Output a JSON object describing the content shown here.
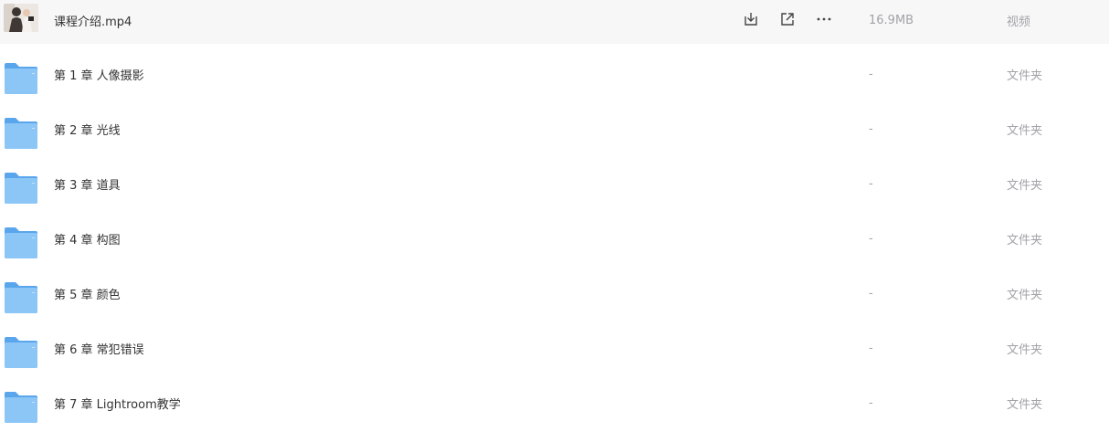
{
  "files": [
    {
      "name": "课程介绍.mp4",
      "size": "16.9MB",
      "type": "视频",
      "icon": "video-thumbnail"
    },
    {
      "name": "第 1 章 人像摄影",
      "size": "-",
      "type": "文件夹",
      "icon": "folder-icon"
    },
    {
      "name": "第 2 章 光线",
      "size": "-",
      "type": "文件夹",
      "icon": "folder-icon"
    },
    {
      "name": "第 3 章 道具",
      "size": "-",
      "type": "文件夹",
      "icon": "folder-icon"
    },
    {
      "name": "第 4 章 构图",
      "size": "-",
      "type": "文件夹",
      "icon": "folder-icon"
    },
    {
      "name": "第 5 章 颜色",
      "size": "-",
      "type": "文件夹",
      "icon": "folder-icon"
    },
    {
      "name": "第 6 章 常犯错误",
      "size": "-",
      "type": "文件夹",
      "icon": "folder-icon"
    },
    {
      "name": "第 7 章 Lightroom教学",
      "size": "-",
      "type": "文件夹",
      "icon": "folder-icon"
    }
  ],
  "row_actions": [
    "download-icon",
    "share-icon",
    "more-icon"
  ],
  "colors": {
    "hover_row": "#f7f7f8",
    "text_primary": "#333333",
    "text_secondary": "#a3a3a8",
    "folder_blue": "#6fb2f0"
  }
}
